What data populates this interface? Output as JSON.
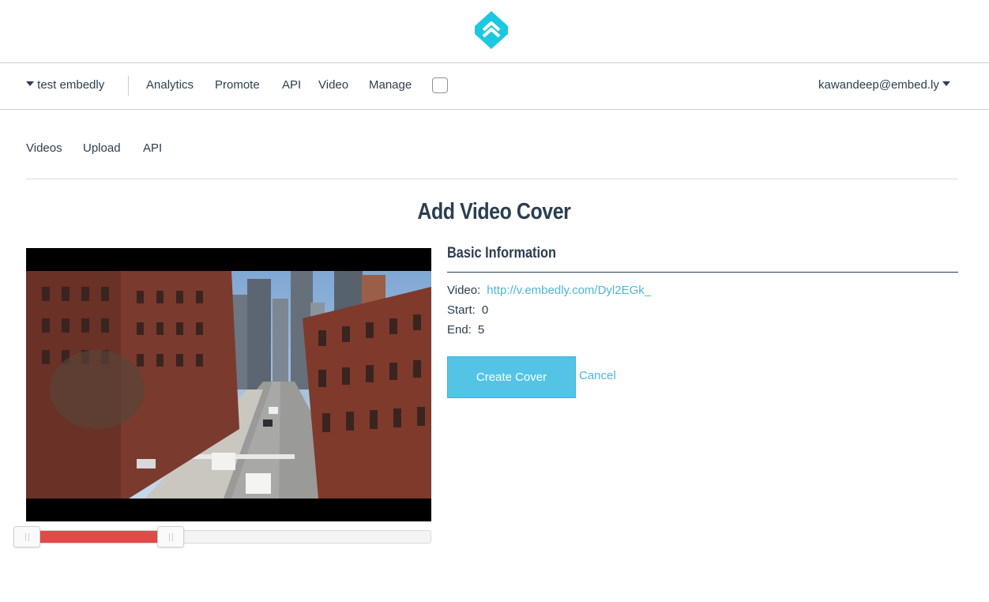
{
  "brand": {
    "logo": "embedly-logo-icon",
    "accent": "#1cc8e0"
  },
  "nav": {
    "app_selector": "test embedly",
    "items": [
      "Analytics",
      "Promote",
      "API",
      "Video",
      "Manage"
    ],
    "user": "kawandeep@embed.ly"
  },
  "subnav": {
    "items": [
      "Videos",
      "Upload",
      "API"
    ]
  },
  "page": {
    "title": "Add Video Cover"
  },
  "info": {
    "heading": "Basic Information",
    "video_label": "Video:",
    "video_url": "http://v.embedly.com/Dyl2EGk_",
    "start_label": "Start:",
    "start_value": "0",
    "end_label": "End:",
    "end_value": "5"
  },
  "actions": {
    "create": "Create Cover",
    "cancel": "Cancel"
  },
  "slider": {
    "start": 0,
    "end": 5,
    "range_color": "#e24a48"
  }
}
